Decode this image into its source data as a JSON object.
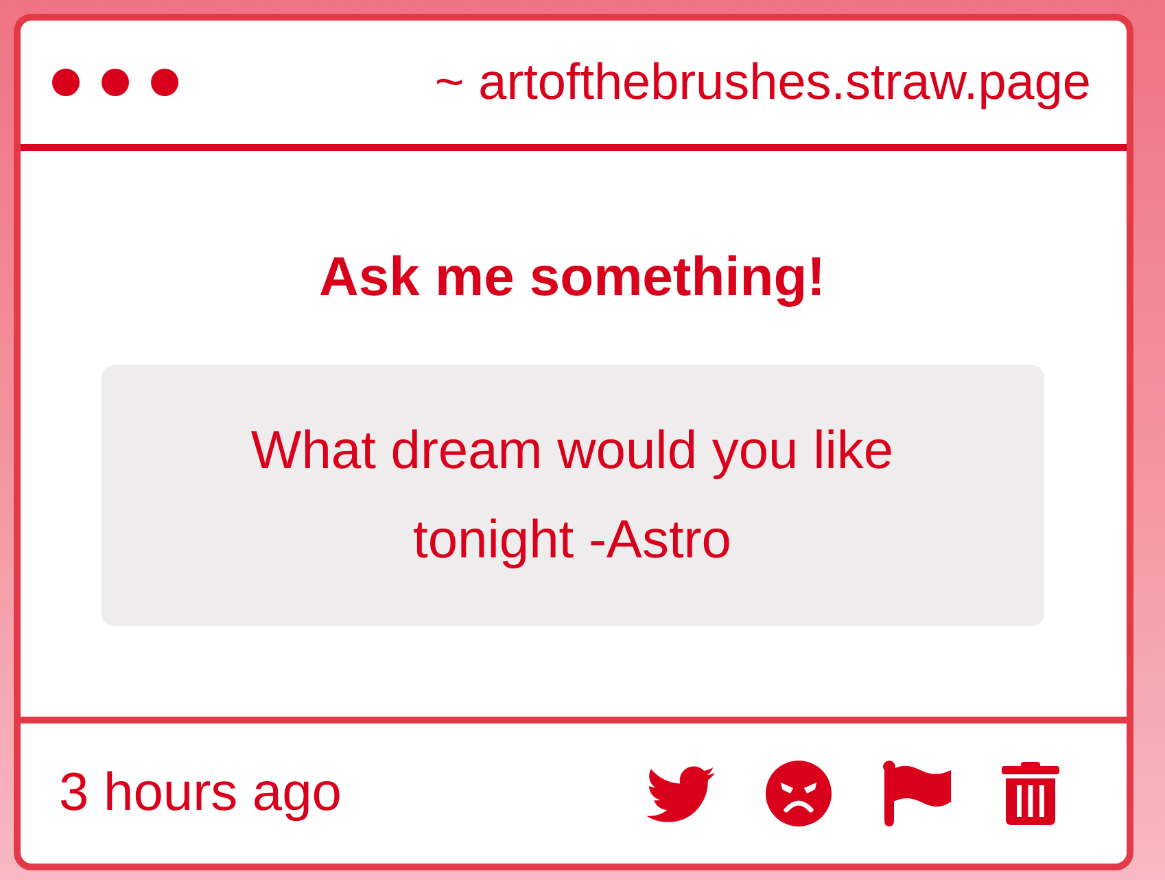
{
  "header": {
    "address": "~ artofthebrushes.straw.page"
  },
  "title": "Ask me something!",
  "question": {
    "text": "What dream would you like tonight -Astro"
  },
  "footer": {
    "time": "3 hours ago",
    "actions": [
      {
        "kind": "twitter"
      },
      {
        "kind": "react"
      },
      {
        "kind": "flag"
      },
      {
        "kind": "delete"
      }
    ]
  }
}
